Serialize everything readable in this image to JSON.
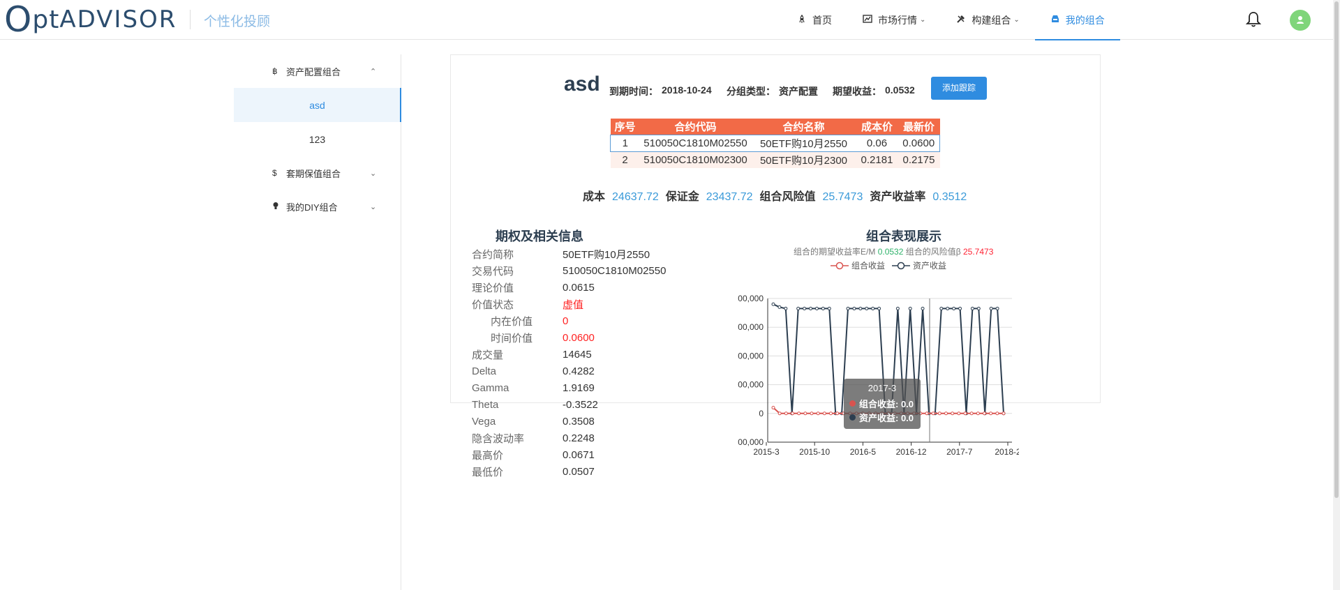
{
  "header": {
    "logo_big": "O",
    "logo_pt": "pt",
    "logo_rest": "ADVISOR",
    "slogan": "个性化投顾",
    "nav": [
      {
        "label": "首页",
        "icon": "rocket-icon"
      },
      {
        "label": "市场行情",
        "icon": "chart-icon"
      },
      {
        "label": "构建组合",
        "icon": "tools-icon"
      },
      {
        "label": "我的组合",
        "icon": "inbox-icon",
        "active": true
      }
    ]
  },
  "sidebar": {
    "groups": [
      {
        "label": "资产配置组合",
        "icon": "bitcoin-icon",
        "items": [
          "asd",
          "123"
        ]
      },
      {
        "label": "套期保值组合",
        "icon": "dollar-icon"
      },
      {
        "label": "我的DIY组合",
        "icon": "bulb-icon"
      }
    ]
  },
  "portfolio": {
    "name": "asd",
    "expiry_label": "到期时间：",
    "expiry": "2018-10-24",
    "type_label": "分组类型：",
    "type": "资产配置",
    "expected_label": "期望收益：",
    "expected": "0.0532",
    "add_button": "添加跟踪"
  },
  "contracts": {
    "headers": [
      "序号",
      "合约代码",
      "合约名称",
      "成本价",
      "最新价"
    ],
    "rows": [
      [
        "1",
        "510050C1810M02550",
        "50ETF购10月2550",
        "0.06",
        "0.0600"
      ],
      [
        "2",
        "510050C1810M02300",
        "50ETF购10月2300",
        "0.2181",
        "0.2175"
      ]
    ]
  },
  "stats": {
    "cost_label": "成本",
    "cost": "24637.72",
    "margin_label": "保证金",
    "margin": "23437.72",
    "risk_label": "组合风险值",
    "risk": "25.7473",
    "return_label": "资产收益率",
    "return": "0.3512"
  },
  "option_info": {
    "title": "期权及相关信息",
    "rows": [
      {
        "label": "合约简称",
        "value": "50ETF购10月2550"
      },
      {
        "label": "交易代码",
        "value": "510050C1810M02550"
      },
      {
        "label": "理论价值",
        "value": "0.0615"
      },
      {
        "label": "价值状态",
        "value": "虚值",
        "red": true
      },
      {
        "label": "内在价值",
        "value": "0",
        "red": true,
        "indent": true
      },
      {
        "label": "时间价值",
        "value": "0.0600",
        "red": true,
        "indent": true
      },
      {
        "label": "成交量",
        "value": "14645"
      },
      {
        "label": "Delta",
        "value": "0.4282"
      },
      {
        "label": "Gamma",
        "value": "1.9169"
      },
      {
        "label": "Theta",
        "value": "-0.3522"
      },
      {
        "label": "Vega",
        "value": "0.3508"
      },
      {
        "label": "隐含波动率",
        "value": "0.2248"
      },
      {
        "label": "最高价",
        "value": "0.0671"
      },
      {
        "label": "最低价",
        "value": "0.0507"
      }
    ]
  },
  "performance": {
    "title": "组合表现展示",
    "em_label": "组合的期望收益率E/M",
    "em": "0.0532",
    "beta_label": "组合的风险值β",
    "beta": "25.7473",
    "tooltip": {
      "title": "2017-3",
      "row1": "组合收益: 0.0",
      "row2": "资产收益: 0.0"
    }
  },
  "colors": {
    "accent": "#2f8ce0",
    "table_header": "#f26a47",
    "series_portfolio": "#d9534f",
    "series_asset": "#2c3e50"
  },
  "chart_data": {
    "type": "line",
    "x_ticks": [
      "2015-3",
      "2015-10",
      "2016-5",
      "2016-12",
      "2017-7",
      "2018-2"
    ],
    "y_ticks": [
      "00,000",
      "00,000",
      "00,000",
      "00,000",
      "0",
      "00,000"
    ],
    "series": [
      {
        "name": "组合收益",
        "values": [
          0.2,
          0,
          0,
          0,
          0,
          0,
          0,
          0,
          0,
          0,
          0,
          0,
          0,
          0,
          0,
          0,
          0,
          0,
          0,
          0,
          0,
          0,
          0,
          0,
          0,
          0,
          0,
          0,
          0,
          0,
          0,
          0,
          0,
          0,
          0,
          0,
          0
        ]
      },
      {
        "name": "资产收益",
        "values": [
          3.8,
          3.7,
          3.65,
          0,
          3.65,
          3.65,
          3.65,
          3.65,
          3.65,
          3.65,
          0,
          0,
          3.65,
          3.65,
          3.65,
          3.65,
          3.65,
          3.65,
          0,
          0,
          3.65,
          0,
          3.65,
          0,
          3.65,
          0,
          0,
          3.65,
          3.65,
          3.65,
          3.65,
          0,
          3.65,
          3.65,
          0,
          3.65,
          3.65,
          0
        ]
      }
    ]
  }
}
